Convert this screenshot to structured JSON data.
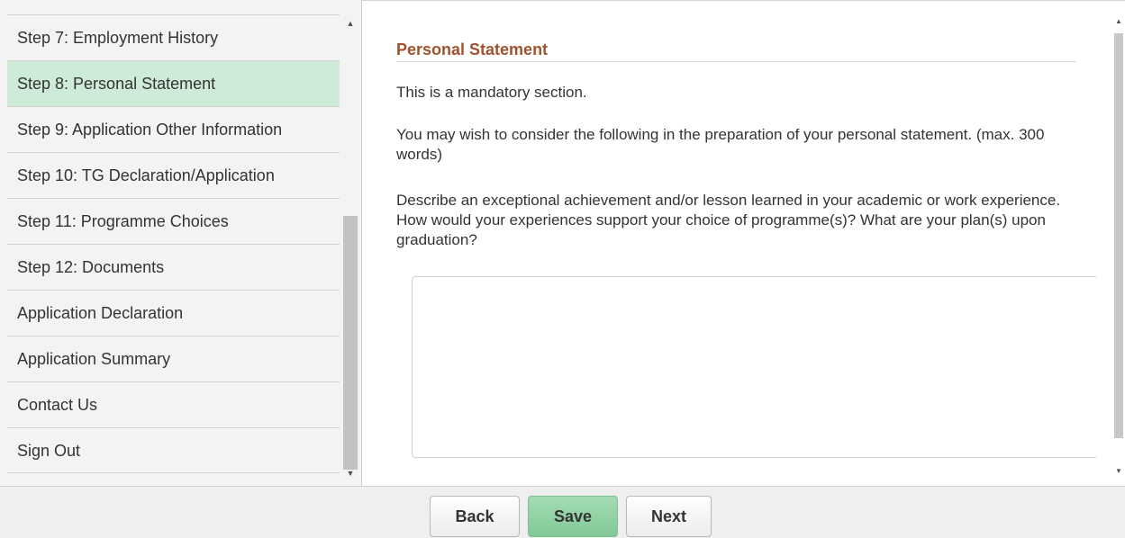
{
  "sidebar": {
    "items": [
      {
        "label": "Step 7: Employment History",
        "active": false
      },
      {
        "label": "Step 8: Personal Statement",
        "active": true
      },
      {
        "label": "Step 9: Application Other Information",
        "active": false
      },
      {
        "label": "Step 10: TG Declaration/Application",
        "active": false
      },
      {
        "label": "Step 11: Programme Choices",
        "active": false
      },
      {
        "label": "Step 12: Documents",
        "active": false
      },
      {
        "label": "Application Declaration",
        "active": false
      },
      {
        "label": "Application Summary",
        "active": false
      },
      {
        "label": "Contact Us",
        "active": false
      },
      {
        "label": "Sign Out",
        "active": false
      }
    ],
    "scroll_up_icon": "triangle-up",
    "scroll_down_icon": "triangle-down"
  },
  "main": {
    "title": "Personal Statement",
    "mandatory_text": "This is a mandatory section.",
    "instructions": "You may wish to consider the following in the preparation of your personal statement. (max. 300 words)",
    "prompt": "Describe an exceptional achievement and/or lesson learned in your academic or work experience. How would your experiences support your choice of programme(s)? What are your plan(s) upon graduation?",
    "statement_value": ""
  },
  "footer": {
    "back_label": "Back",
    "save_label": "Save",
    "next_label": "Next"
  },
  "colors": {
    "active_item_bg": "#cdebd6",
    "title_color": "#a0522d",
    "save_button": "#8ed1a2"
  }
}
